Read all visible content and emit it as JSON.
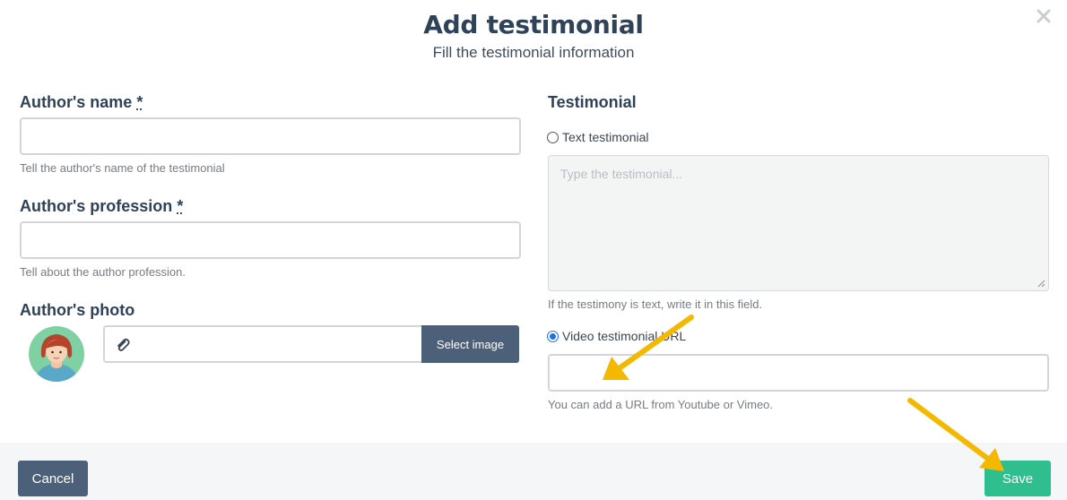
{
  "modal": {
    "title": "Add testimonial",
    "subtitle": "Fill the testimonial information"
  },
  "left": {
    "author_name": {
      "label": "Author's name",
      "required_mark": "*",
      "value": "",
      "help": "Tell the author's name of the testimonial"
    },
    "author_profession": {
      "label": "Author's profession",
      "required_mark": "*",
      "value": "",
      "help": "Tell about the author profession."
    },
    "author_photo": {
      "label": "Author's photo",
      "file_value": "",
      "select_button": "Select image"
    }
  },
  "right": {
    "section_label": "Testimonial",
    "text_option": {
      "label": "Text testimonial",
      "checked": false
    },
    "textarea": {
      "placeholder": "Type the testimonial...",
      "value": ""
    },
    "text_help": "If the testimony is text, write it in this field.",
    "video_option": {
      "label": "Video testimonial URL",
      "checked": true
    },
    "video_url": {
      "value": ""
    },
    "video_help": "You can add a URL from Youtube or Vimeo."
  },
  "footer": {
    "cancel_label": "Cancel",
    "save_label": "Save"
  },
  "colors": {
    "primary_button": "#4c6079",
    "save_button": "#2fbf8f",
    "annotation_arrow": "#f5b800",
    "heading": "#2f4257"
  },
  "icons": {
    "close": "close-icon",
    "attachment": "paperclip-icon",
    "avatar": "user-avatar"
  }
}
